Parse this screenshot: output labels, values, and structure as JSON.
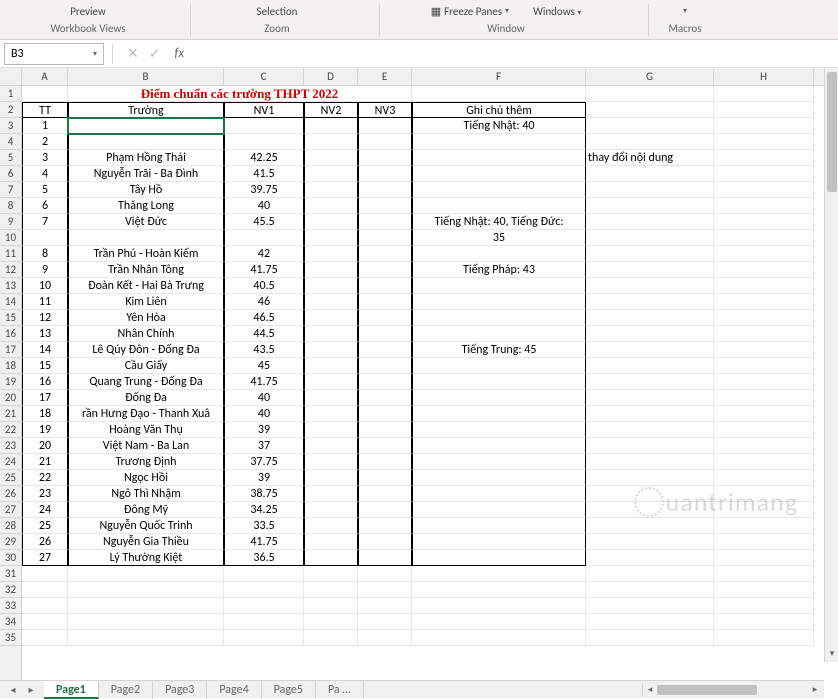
{
  "ribbon": {
    "views": {
      "preview": "Preview",
      "label": "Workbook Views"
    },
    "zoom": {
      "selection": "Selection",
      "label": "Zoom"
    },
    "window": {
      "freeze": "Freeze Panes",
      "windows": "Windows",
      "label": "Window"
    },
    "macros": {
      "label": "Macros"
    }
  },
  "namebox": "B3",
  "columns": [
    "A",
    "B",
    "C",
    "D",
    "E",
    "F",
    "G",
    "H"
  ],
  "row_count": 35,
  "title": "Điểm chuẩn các trường THPT 2022",
  "headers": {
    "tt": "TT",
    "truong": "Trường",
    "nv1": "NV1",
    "nv2": "NV2",
    "nv3": "NV3",
    "ghichu": "Ghi chú thêm"
  },
  "note_outside": "thay đổi nội dung",
  "rows": [
    {
      "tt": "1",
      "truong": "",
      "nv1": "",
      "ghichu": "Tiếng Nhật: 40"
    },
    {
      "tt": "2",
      "truong": "",
      "nv1": "",
      "ghichu": ""
    },
    {
      "tt": "3",
      "truong": "Phạm Hồng Thái",
      "nv1": "42.25",
      "ghichu": ""
    },
    {
      "tt": "4",
      "truong": "Nguyễn Trãi - Ba Đình",
      "nv1": "41.5",
      "ghichu": ""
    },
    {
      "tt": "5",
      "truong": "Tây Hồ",
      "nv1": "39.75",
      "ghichu": ""
    },
    {
      "tt": "6",
      "truong": "Thăng Long",
      "nv1": "40",
      "ghichu": ""
    },
    {
      "tt": "7",
      "truong": "Việt Đức",
      "nv1": "45.5",
      "ghichu": "Tiếng Nhật: 40, Tiếng Đức:"
    },
    {
      "tt": "",
      "truong": "",
      "nv1": "",
      "ghichu": "35"
    },
    {
      "tt": "8",
      "truong": "Trần Phú - Hoàn Kiếm",
      "nv1": "42",
      "ghichu": ""
    },
    {
      "tt": "9",
      "truong": "Trần Nhân Tông",
      "nv1": "41.75",
      "ghichu": "Tiếng Pháp: 43"
    },
    {
      "tt": "10",
      "truong": "Đoàn Kết - Hai Bà Trưng",
      "nv1": "40.5",
      "ghichu": ""
    },
    {
      "tt": "11",
      "truong": "Kim Liên",
      "nv1": "46",
      "ghichu": ""
    },
    {
      "tt": "12",
      "truong": "Yên Hòa",
      "nv1": "46.5",
      "ghichu": ""
    },
    {
      "tt": "13",
      "truong": "Nhân Chính",
      "nv1": "44.5",
      "ghichu": ""
    },
    {
      "tt": "14",
      "truong": "Lê Qúy Đôn - Đống Đa",
      "nv1": "43.5",
      "ghichu": "Tiếng Trung: 45"
    },
    {
      "tt": "15",
      "truong": "Cầu Giấy",
      "nv1": "45",
      "ghichu": ""
    },
    {
      "tt": "16",
      "truong": "Quang Trung - Đống Đa",
      "nv1": "41.75",
      "ghichu": ""
    },
    {
      "tt": "17",
      "truong": "Đống Đa",
      "nv1": "40",
      "ghichu": ""
    },
    {
      "tt": "18",
      "truong": "rần Hưng Đạo - Thanh Xuâ",
      "nv1": "40",
      "ghichu": ""
    },
    {
      "tt": "19",
      "truong": "Hoàng Văn Thụ",
      "nv1": "39",
      "ghichu": ""
    },
    {
      "tt": "20",
      "truong": "Việt Nam - Ba Lan",
      "nv1": "37",
      "ghichu": ""
    },
    {
      "tt": "21",
      "truong": "Trương Định",
      "nv1": "37.75",
      "ghichu": ""
    },
    {
      "tt": "22",
      "truong": "Ngọc Hồi",
      "nv1": "39",
      "ghichu": ""
    },
    {
      "tt": "23",
      "truong": "Ngô Thì Nhậm",
      "nv1": "38.75",
      "ghichu": ""
    },
    {
      "tt": "24",
      "truong": "Đông Mỹ",
      "nv1": "34.25",
      "ghichu": ""
    },
    {
      "tt": "25",
      "truong": "Nguyễn Quốc Trinh",
      "nv1": "33.5",
      "ghichu": ""
    },
    {
      "tt": "26",
      "truong": "Nguyễn Gia Thiều",
      "nv1": "41.75",
      "ghichu": ""
    },
    {
      "tt": "27",
      "truong": "Lý Thường Kiệt",
      "nv1": "36.5",
      "ghichu": ""
    }
  ],
  "tabs": [
    "Page1",
    "Page2",
    "Page3",
    "Page4",
    "Page5",
    "Pa …"
  ],
  "active_tab": 0,
  "watermark": "uantrimang"
}
